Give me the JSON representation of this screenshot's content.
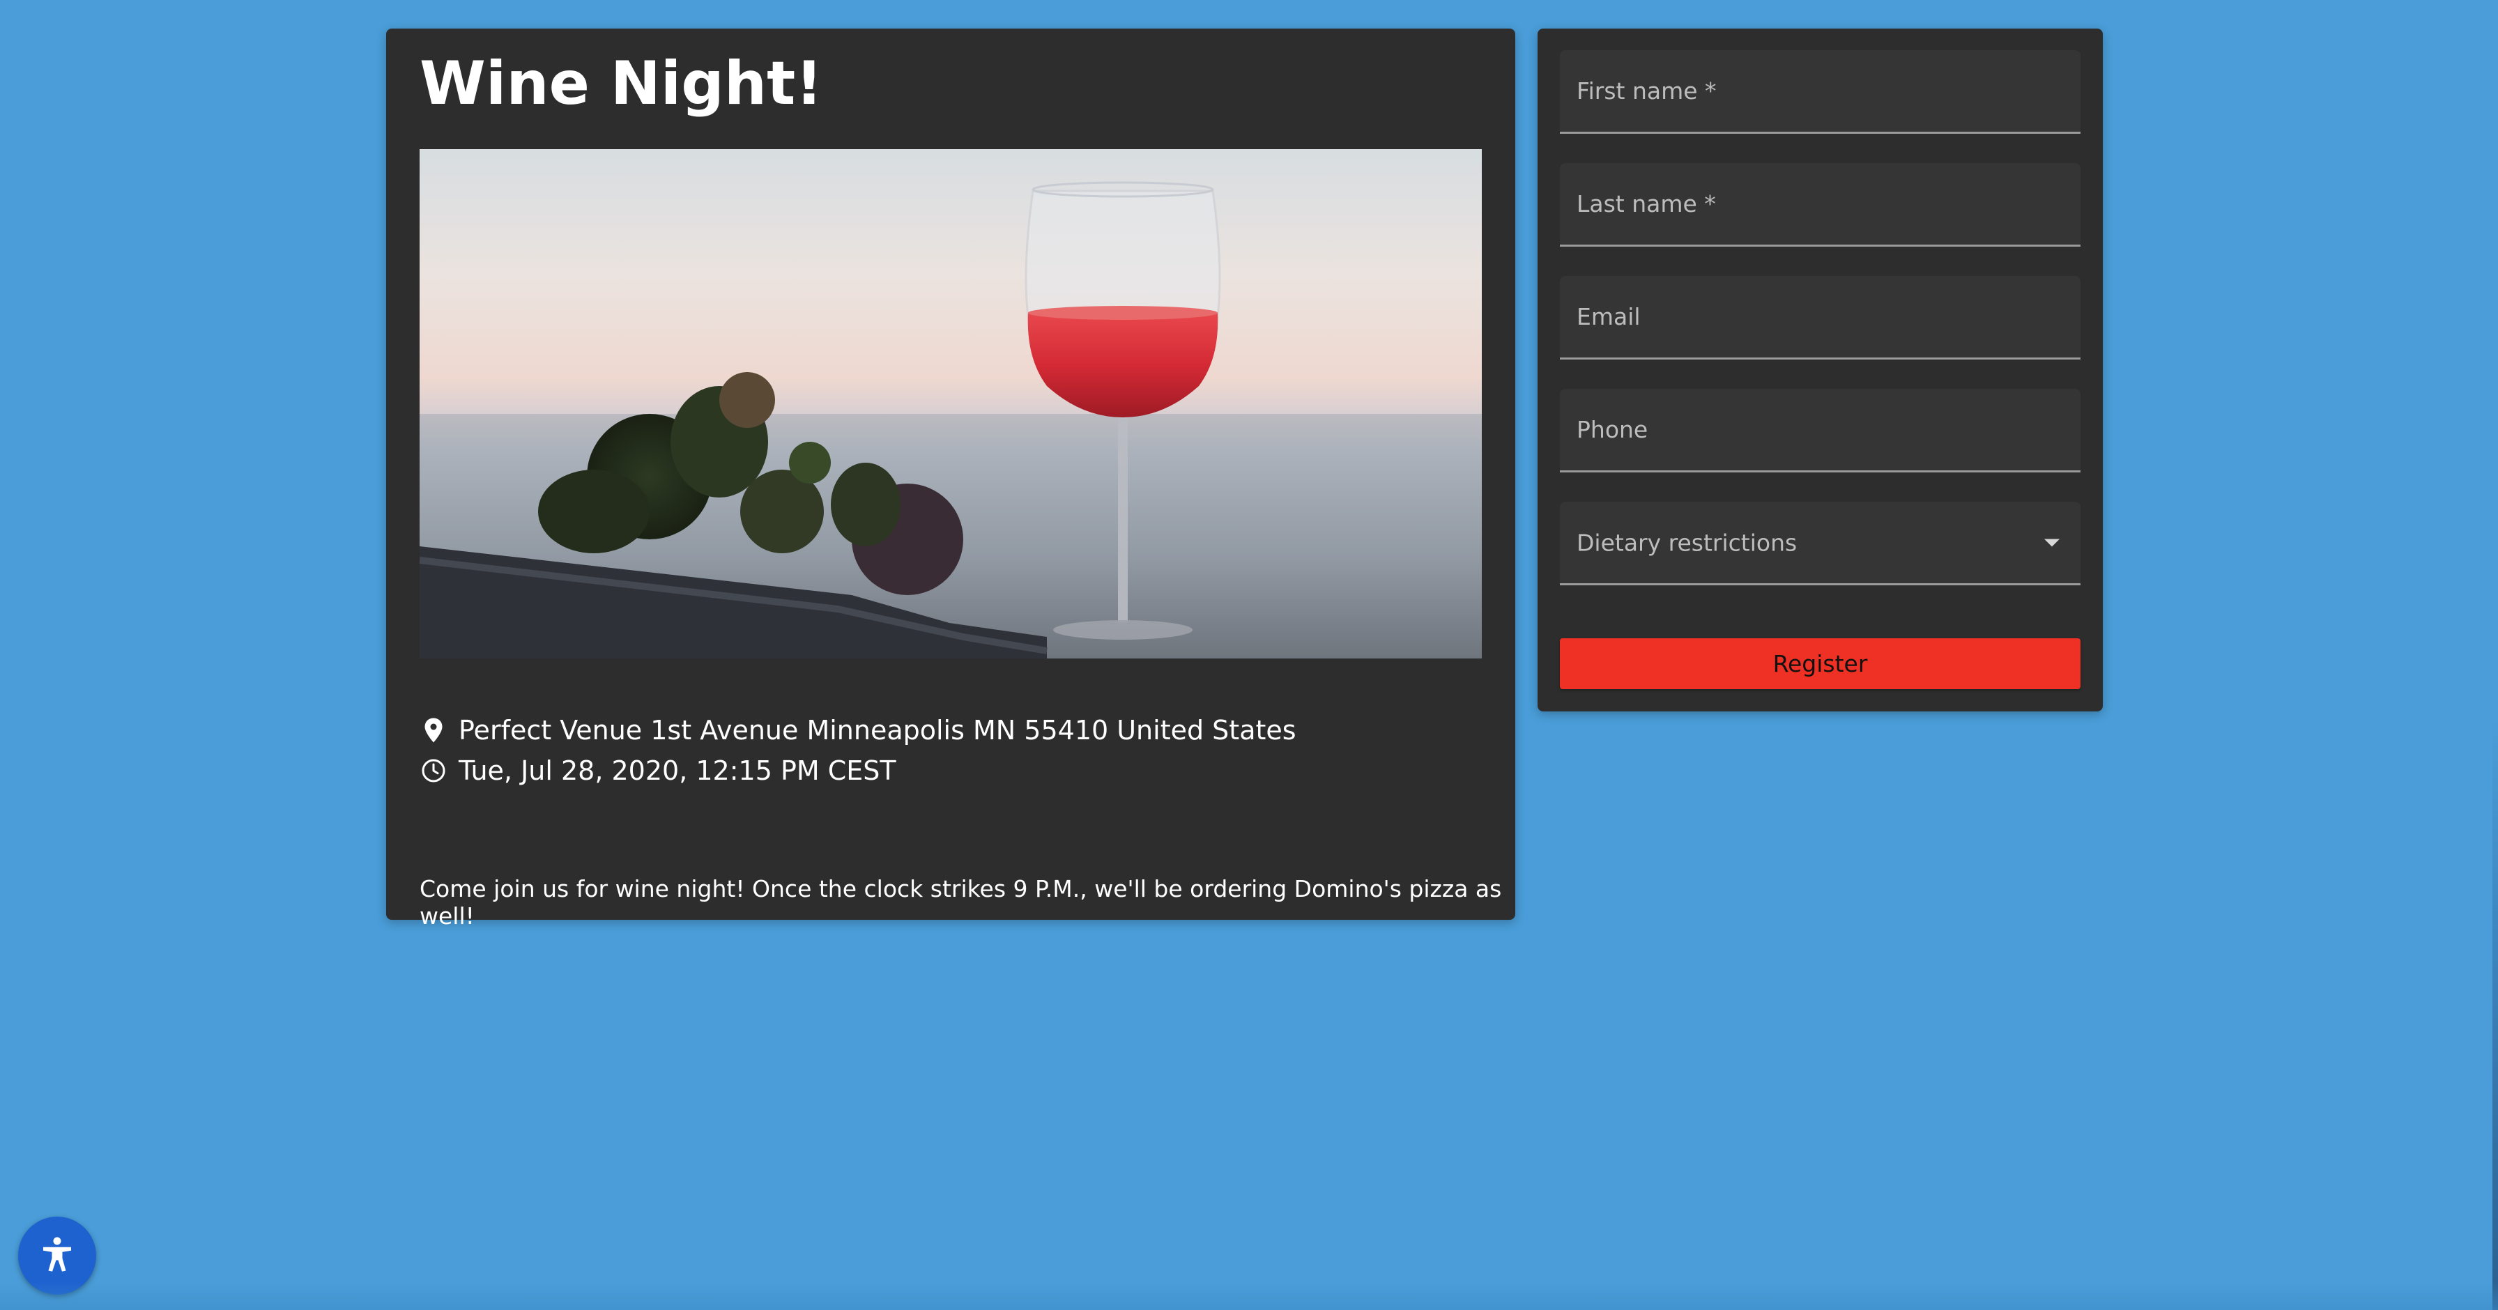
{
  "event": {
    "title": "Wine Night!",
    "image_alt": "Glass of red wine by the sea at dusk",
    "venue": "Perfect Venue 1st Avenue Minneapolis MN 55410 United States",
    "datetime": "Tue, Jul 28, 2020, 12:15 PM CEST",
    "description": "Come join us for wine night! Once the clock strikes 9 P.M., we'll be ordering Domino's pizza as well!"
  },
  "form": {
    "first_name": {
      "placeholder": "First name *",
      "value": ""
    },
    "last_name": {
      "placeholder": "Last name *",
      "value": ""
    },
    "email": {
      "placeholder": "Email",
      "value": ""
    },
    "phone": {
      "placeholder": "Phone",
      "value": ""
    },
    "dietary": {
      "label": "Dietary restrictions"
    },
    "register_label": "Register"
  },
  "icons": {
    "venue": "map-pin-icon",
    "datetime": "clock-icon",
    "dietary": "chevron-down-icon",
    "accessibility": "accessibility-icon"
  },
  "colors": {
    "page_background": "#4a9dd8",
    "card_background": "#2d2d2d",
    "register_button": "#ee3124",
    "accessibility_button": "#1e62d0"
  }
}
